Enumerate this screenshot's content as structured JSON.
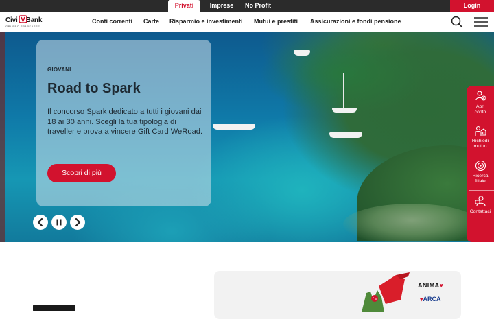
{
  "segments": {
    "items": [
      "Privati",
      "Imprese",
      "No Profit"
    ],
    "active": "Privati",
    "login_label": "Login"
  },
  "brand": {
    "name_part1": "Civi",
    "name_part2": "Bank",
    "subline": "GRUPPO SPARKASSE",
    "accent_color": "#d2122e"
  },
  "nav": {
    "links": [
      "Conti correnti",
      "Carte",
      "Risparmio e investimenti",
      "Mutui e prestiti",
      "Assicurazioni e fondi pensione"
    ],
    "search_icon": "search-icon",
    "menu_icon": "hamburger-menu-icon"
  },
  "hero": {
    "kicker": "GIOVANI",
    "title": "Road to Spark",
    "text": "Il concorso Spark dedicato a tutti i giovani dai 18 ai 30 anni. Scegli la tua tipologia di traveller e prova a vincere Gift Card WeRoad.",
    "cta_label": "Scopri di più",
    "controls": [
      "chevron-left-icon",
      "pause-icon",
      "chevron-right-icon"
    ]
  },
  "dock": {
    "items": [
      {
        "label_1": "Apri",
        "label_2": "conto",
        "icon": "open-account-icon"
      },
      {
        "label_1": "Richiedi",
        "label_2": "mutuo",
        "icon": "mortgage-icon"
      },
      {
        "label_1": "Ricerca",
        "label_2": "filiale",
        "icon": "branch-locator-icon"
      },
      {
        "label_1": "Contattaci",
        "label_2": "",
        "icon": "contact-icon"
      }
    ]
  },
  "promo": {
    "brand_1": "ANIMA",
    "brand_2": "ARCA"
  }
}
